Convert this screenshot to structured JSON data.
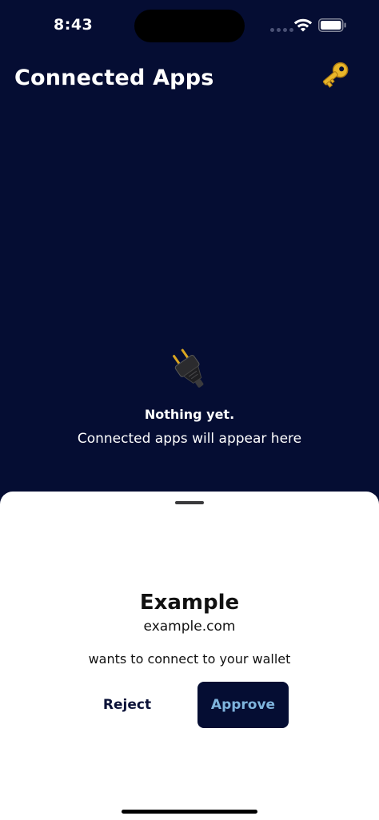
{
  "status_bar": {
    "time": "8:43"
  },
  "header": {
    "title": "Connected Apps",
    "action_icon": "key-icon"
  },
  "empty_state": {
    "icon": "plug-icon",
    "title": "Nothing yet.",
    "subtitle": "Connected apps will appear here"
  },
  "connect_sheet": {
    "app_name": "Example",
    "app_domain": "example.com",
    "request_text": "wants to connect to your wallet",
    "reject_label": "Reject",
    "approve_label": "Approve"
  },
  "colors": {
    "background": "#050d33",
    "sheet_background": "#ffffff",
    "approve_text": "#7fb4dd",
    "key_gold": "#e9b62a"
  }
}
